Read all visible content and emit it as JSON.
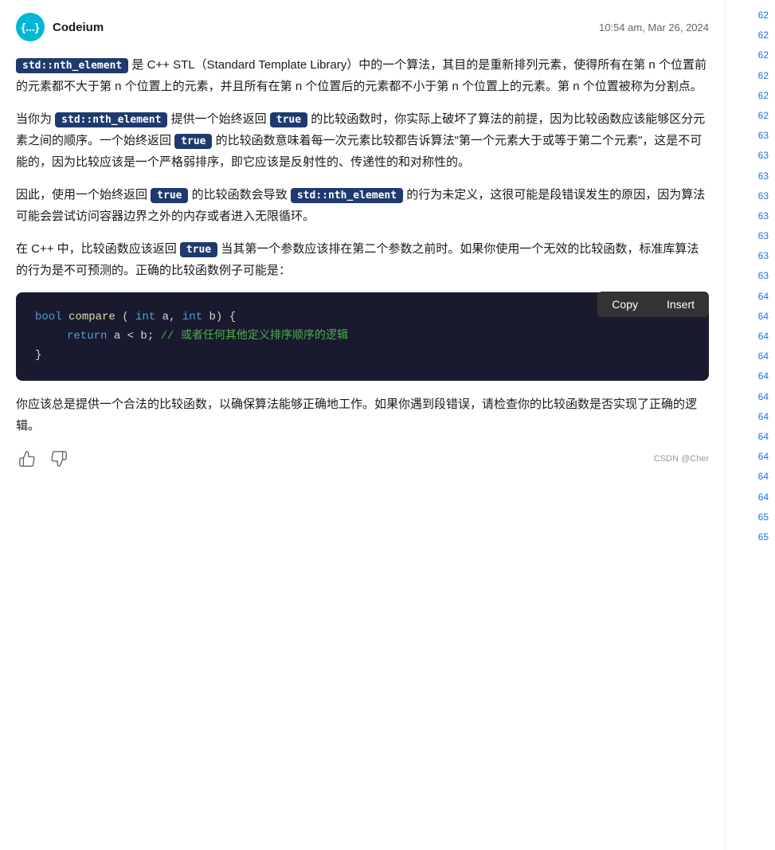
{
  "header": {
    "sender": "Codeium",
    "avatar_text": "{...}",
    "avatar_bg": "#00b8d4",
    "timestamp": "10:54 am, Mar 26, 2024"
  },
  "paragraphs": [
    {
      "id": "p1",
      "text_before": "",
      "code1": "std::nth_element",
      "text_after": " 是 C++ STL（Standard Template Library）中的一个算法，其目的是重新排列元素，使得所有在第 n 个位置前的元素都不大于第 n 个位置上的元素，并且所有在第 n 个位置后的元素都不小于第 n 个位置上的元素。第 n 个位置被称为分割点。"
    },
    {
      "id": "p2",
      "text_before": "当你为 ",
      "code1": "std::nth_element",
      "text_middle1": " 提供一个始终返回 ",
      "code2": "true",
      "text_middle2": " 的比较函数时，你实际上破坏了算法的前提，因为比较函数应该能够区分元素之间的顺序。一个始终返回 ",
      "code3": "true",
      "text_after": " 的比较函数意味着每一次元素比较都告诉算法\"第一个元素大于或等于第二个元素\"，这是不可能的，因为比较应该是一个严格弱排序，即它应该是反射性的、传递性的和对称性的。"
    },
    {
      "id": "p3",
      "text_before": "因此，使用一个始终返回 ",
      "code1": "true",
      "text_middle": " 的比较函数会导致 ",
      "code2": "std::nth_element",
      "text_after": " 的行为未定义，这很可能是段错误发生的原因，因为算法可能会尝试访问容器边界之外的内存或者进入无限循环。"
    },
    {
      "id": "p4",
      "text_before": "在 C++ 中，比较函数应该返回 ",
      "code1": "true",
      "text_after": " 当其第一个参数应该排在第二个参数之前时。如果你使用一个无效的比较函数，标准库算法的行为是不可预测的。正确的比较函数例子可能是："
    }
  ],
  "code_block": {
    "lines": [
      {
        "indent": 0,
        "parts": [
          {
            "type": "kw",
            "text": "bool"
          },
          {
            "type": "normal",
            "text": " "
          },
          {
            "type": "fn",
            "text": "compare"
          },
          {
            "type": "normal",
            "text": "("
          },
          {
            "type": "kw",
            "text": "int"
          },
          {
            "type": "normal",
            "text": " a, "
          },
          {
            "type": "kw",
            "text": "int"
          },
          {
            "type": "normal",
            "text": " b) {"
          }
        ]
      },
      {
        "indent": 1,
        "parts": [
          {
            "type": "kw",
            "text": "return"
          },
          {
            "type": "normal",
            "text": " a < b; "
          },
          {
            "type": "comment",
            "text": "// 或者任何其他定义排序顺序的逻辑"
          }
        ]
      },
      {
        "indent": 0,
        "parts": [
          {
            "type": "normal",
            "text": "}"
          }
        ]
      }
    ],
    "copy_label": "Copy",
    "insert_label": "Insert"
  },
  "last_paragraph": "你应该总是提供一个合法的比较函数，以确保算法能够正确地工作。如果你遇到段错误，请检查你的比较函数是否实现了正确的逻辑。",
  "watermark": "CSDN @Cher",
  "line_numbers": [
    "62",
    "62",
    "62",
    "62",
    "62",
    "62",
    "63",
    "63",
    "63",
    "63",
    "63",
    "63",
    "63",
    "63",
    "64",
    "64",
    "64",
    "64",
    "64",
    "64",
    "64",
    "64",
    "64",
    "64",
    "64",
    "65"
  ],
  "feedback": {
    "like_icon": "👍",
    "dislike_icon": "👎"
  }
}
